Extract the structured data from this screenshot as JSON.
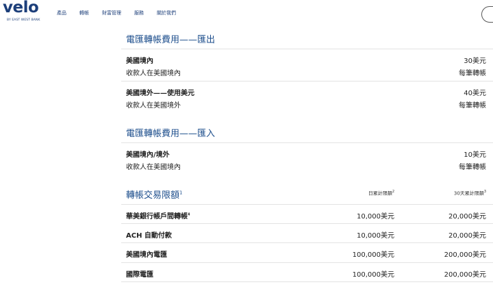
{
  "brand": {
    "logo_text": "velo",
    "logo_sub": "BY EAST WEST BANK",
    "color": "#1d3f7a",
    "accent": "#1d4e8c"
  },
  "nav": [
    "產品",
    "轉帳",
    "財富管理",
    "服務",
    "關於我們"
  ],
  "outbound": {
    "title": "電匯轉帳費用——匯出",
    "rows": [
      {
        "name": "美國境內",
        "sub": "收款人在美國境內",
        "fee": "30美元",
        "unit": "每筆轉帳"
      },
      {
        "name": "美國境外——使用美元",
        "sub": "收款人在美國境外",
        "fee": "40美元",
        "unit": "每筆轉帳"
      }
    ]
  },
  "inbound": {
    "title": "電匯轉帳費用——匯入",
    "rows": [
      {
        "name": "美國境內/境外",
        "sub": "收款人在美國境內",
        "fee": "10美元",
        "unit": "每筆轉帳"
      }
    ]
  },
  "limits": {
    "title": "轉帳交易限額",
    "title_sup": "1",
    "col_daily": "日累計限額",
    "col_daily_sup": "2",
    "col_30day": "30天累計限額",
    "col_30day_sup": "3",
    "rows": [
      {
        "name": "華美銀行帳戶間轉帳",
        "sup": "4",
        "daily": "10,000美元",
        "monthly": "20,000美元"
      },
      {
        "name": "ACH 自動付款",
        "sup": "",
        "daily": "10,000美元",
        "monthly": "20,000美元"
      },
      {
        "name": "美國境內電匯",
        "sup": "",
        "daily": "100,000美元",
        "monthly": "200,000美元"
      },
      {
        "name": "國際電匯",
        "sup": "",
        "daily": "100,000美元",
        "monthly": "200,000美元"
      }
    ]
  }
}
